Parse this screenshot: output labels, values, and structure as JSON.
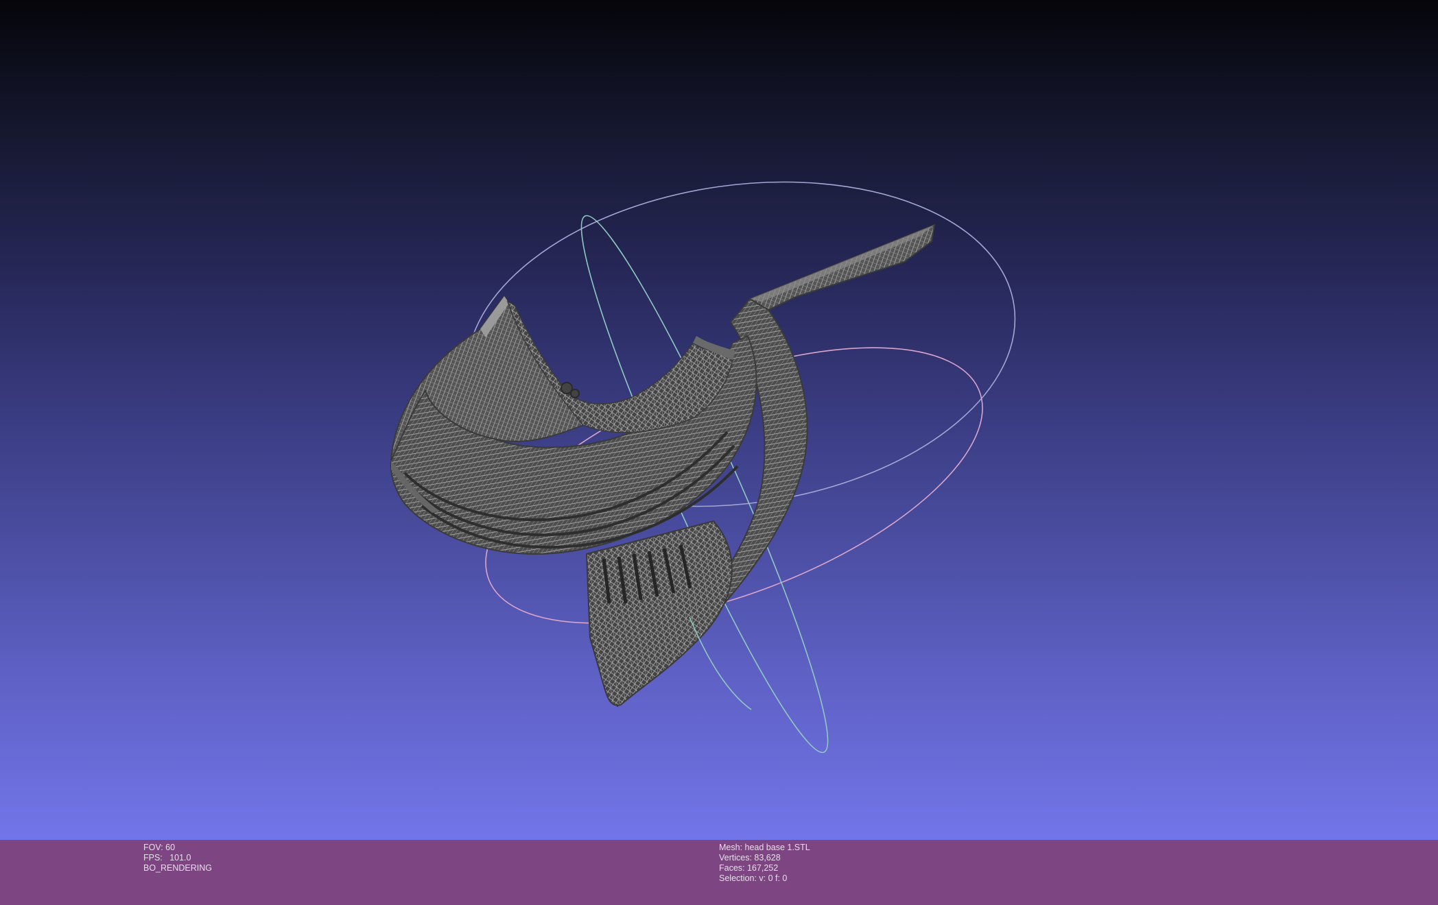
{
  "viewer": {
    "background_top": "#05050a",
    "background_bottom": "#7275e8",
    "mesh_color": "#5a5a5a",
    "wire_color": "#bdbdbd",
    "trackball_colors": [
      "#8fc8c0",
      "#d8a2c8",
      "#a9a9d4"
    ]
  },
  "status_left": {
    "fov": "FOV: 60",
    "fps": "FPS:   101.0",
    "mode": "BO_RENDERING"
  },
  "status_right": {
    "mesh": "Mesh: head base 1.STL",
    "vertices": "Vertices: 83,628",
    "faces": "Faces: 167,252",
    "selection": "Selection: v: 0 f: 0"
  },
  "status_bar_color": "#7d4682"
}
